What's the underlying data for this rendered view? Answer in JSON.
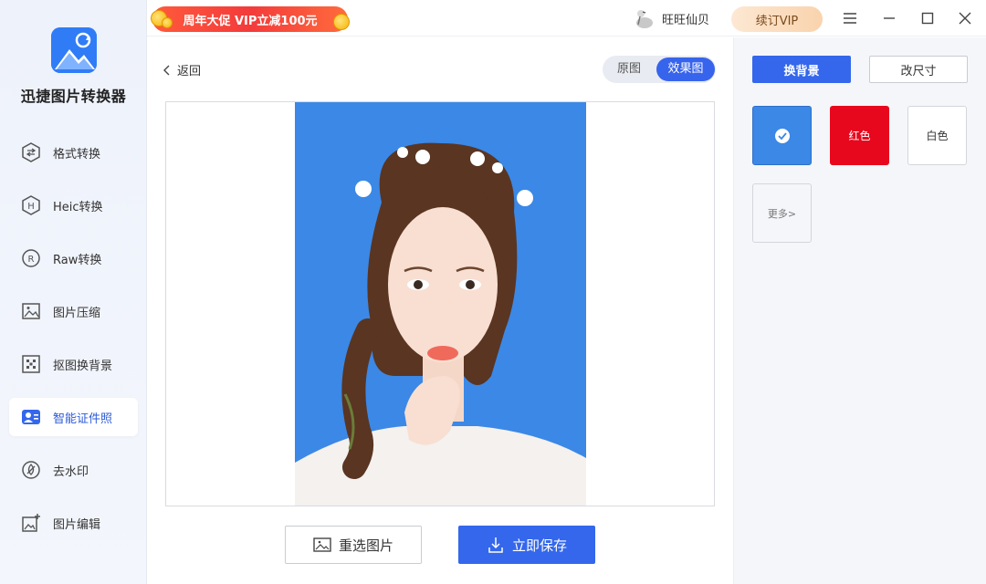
{
  "app": {
    "name": "迅捷图片转换器"
  },
  "sidebar": {
    "items": [
      {
        "label": "格式转换",
        "icon": "format-convert-icon"
      },
      {
        "label": "Heic转换",
        "icon": "heic-icon"
      },
      {
        "label": "Raw转换",
        "icon": "raw-icon"
      },
      {
        "label": "图片压缩",
        "icon": "image-compress-icon"
      },
      {
        "label": "抠图换背景",
        "icon": "cutout-icon"
      },
      {
        "label": "智能证件照",
        "icon": "id-photo-icon"
      },
      {
        "label": "去水印",
        "icon": "watermark-remove-icon"
      },
      {
        "label": "图片编辑",
        "icon": "image-edit-icon"
      }
    ],
    "active_index": 5
  },
  "topbar": {
    "promo_text": "周年大促 VIP立减100元",
    "username": "旺旺仙贝",
    "vip_label": "续订VIP"
  },
  "main": {
    "back_label": "返回",
    "toggle": {
      "original": "原图",
      "effect": "效果图"
    },
    "reselect_label": "重选图片",
    "save_label": "立即保存"
  },
  "right": {
    "tab_background": "换背景",
    "tab_resize": "改尺寸",
    "swatches": {
      "red_label": "红色",
      "white_label": "白色",
      "more_label": "更多>"
    }
  },
  "colors": {
    "accent": "#3467ec",
    "photo_bg_blue": "#3b88e6",
    "red": "#e8081d"
  }
}
